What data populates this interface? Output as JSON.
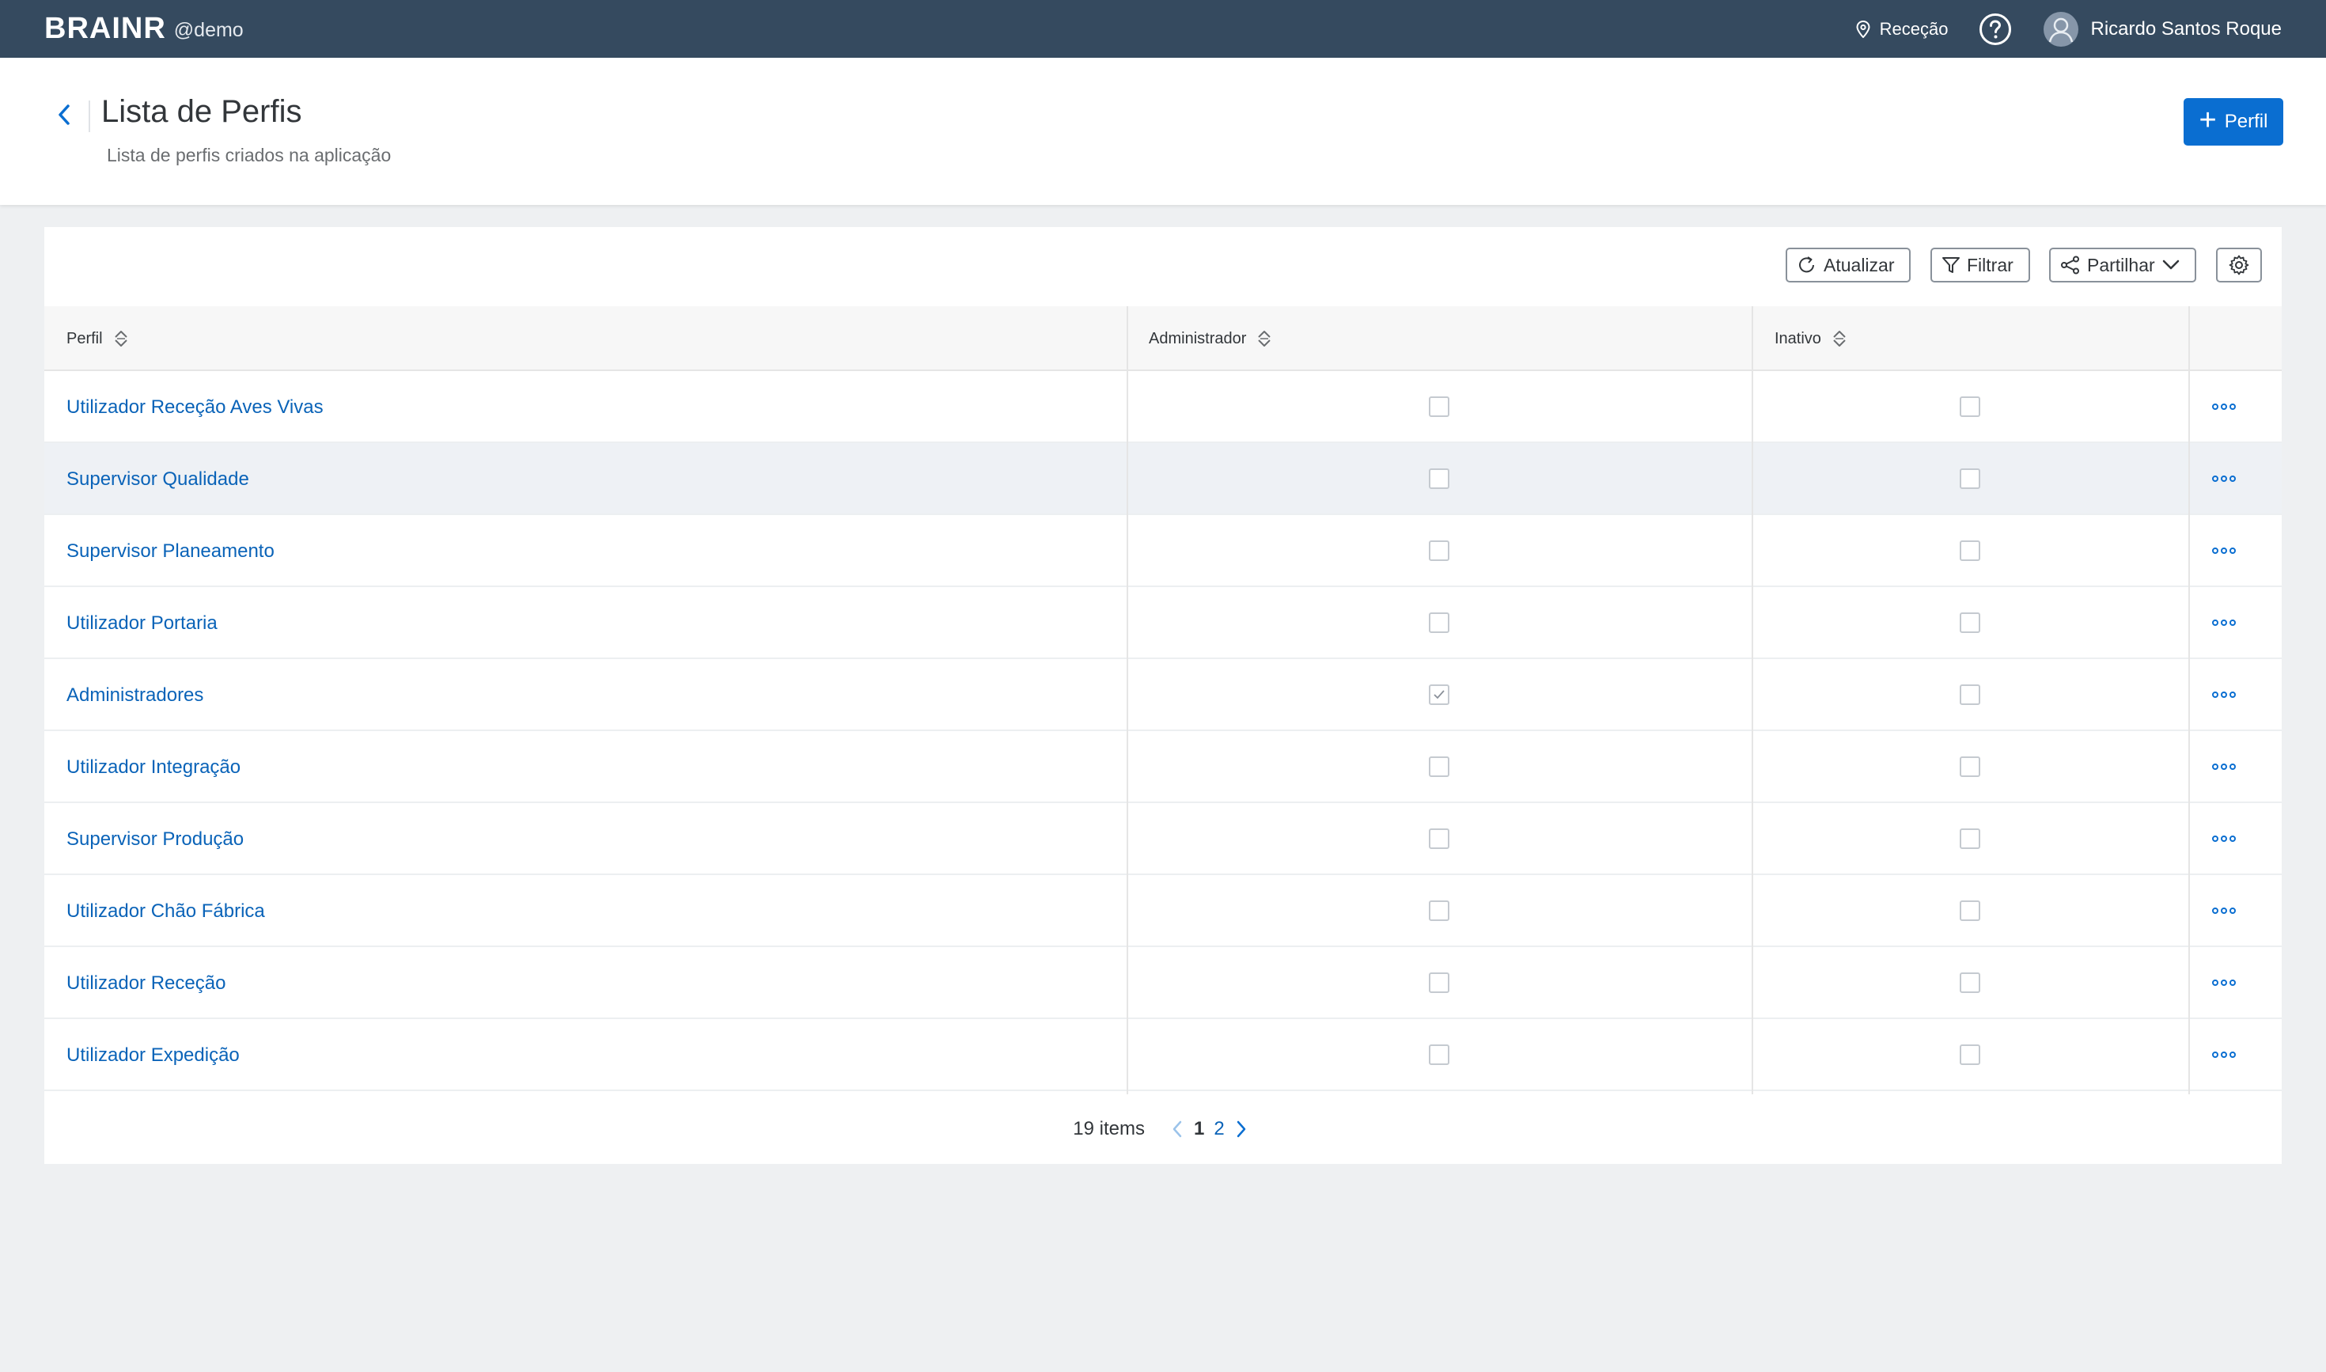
{
  "shell": {
    "brand": "BRAINR",
    "tenant": "@demo",
    "location": "Receção",
    "user_name": "Ricardo Santos Roque"
  },
  "header": {
    "title": "Lista de Perfis",
    "subtitle": "Lista de perfis criados na aplicação",
    "add_label": "Perfil"
  },
  "toolbar": {
    "refresh_label": "Atualizar",
    "filter_label": "Filtrar",
    "share_label": "Partilhar"
  },
  "table": {
    "columns": [
      "Perfil",
      "Administrador",
      "Inativo"
    ],
    "rows": [
      {
        "name": "Utilizador Receção Aves Vivas",
        "admin": false,
        "inactive": false
      },
      {
        "name": "Supervisor Qualidade",
        "admin": false,
        "inactive": false
      },
      {
        "name": "Supervisor Planeamento",
        "admin": false,
        "inactive": false
      },
      {
        "name": "Utilizador Portaria",
        "admin": false,
        "inactive": false
      },
      {
        "name": "Administradores",
        "admin": true,
        "inactive": false
      },
      {
        "name": "Utilizador Integração",
        "admin": false,
        "inactive": false
      },
      {
        "name": "Supervisor Produção",
        "admin": false,
        "inactive": false
      },
      {
        "name": "Utilizador Chão Fábrica",
        "admin": false,
        "inactive": false
      },
      {
        "name": "Utilizador Receção",
        "admin": false,
        "inactive": false
      },
      {
        "name": "Utilizador Expedição",
        "admin": false,
        "inactive": false
      }
    ]
  },
  "pagination": {
    "count_label": "19 items",
    "pages": [
      "1",
      "2"
    ],
    "current": "1"
  },
  "colors": {
    "shell_bg": "#354a5f",
    "accent": "#0a6ed1",
    "link": "#0a63b8",
    "page_bg": "#eef0f2"
  },
  "icons": {
    "back": "chevron-left-icon",
    "location": "map-pin-icon",
    "help": "question-circle-icon",
    "avatar": "user-avatar-icon",
    "add": "plus-icon",
    "refresh": "refresh-icon",
    "filter": "filter-icon",
    "share": "share-icon",
    "settings": "gear-icon",
    "sort": "sort-icon",
    "row_actions": "more-horizontal-icon"
  }
}
